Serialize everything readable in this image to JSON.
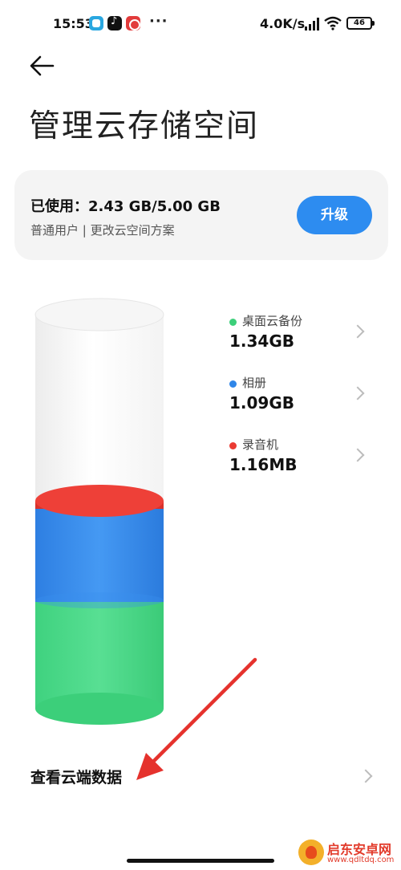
{
  "status_bar": {
    "time": "15:53",
    "more": "···",
    "network_speed": "4.0K/s",
    "battery": "46",
    "icons": [
      "app-icon-1",
      "tiktok-icon",
      "app-icon-3",
      "signal-icon",
      "wifi-icon",
      "battery-icon"
    ]
  },
  "header": {
    "back_icon": "arrow-left-icon",
    "title": "管理云存储空间"
  },
  "usage_card": {
    "used_text": "已使用：2.43 GB/5.00 GB",
    "subtitle": "普通用户 | 更改云空间方案",
    "upgrade_label": "升级"
  },
  "storage": {
    "total_gb": 5.0,
    "used_gb": 2.43,
    "items": [
      {
        "name": "桌面云备份",
        "size": "1.34GB",
        "color": "#3ccf7a",
        "icon": "chevron-right-icon"
      },
      {
        "name": "相册",
        "size": "1.09GB",
        "color": "#2f86e8",
        "icon": "chevron-right-icon"
      },
      {
        "name": "录音机",
        "size": "1.16MB",
        "color": "#ea3b33",
        "icon": "chevron-right-icon"
      }
    ]
  },
  "cloud_data": {
    "label": "查看云端数据",
    "icon": "chevron-right-icon"
  },
  "annotation": {
    "arrow_color": "#e5322d"
  },
  "watermark": {
    "title": "启东安卓网",
    "url": "www.qdltdq.com"
  }
}
